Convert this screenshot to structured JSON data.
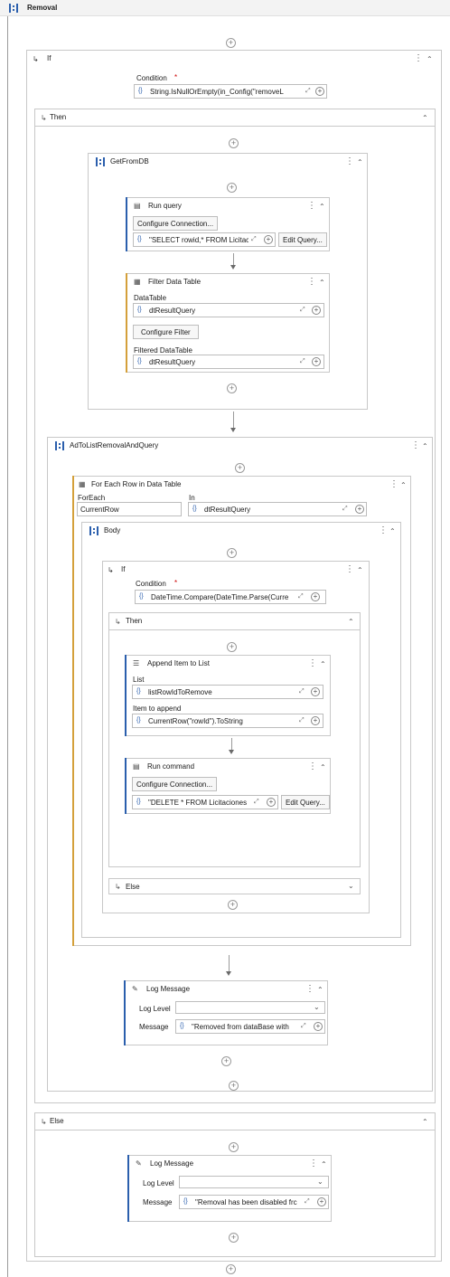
{
  "root": {
    "title": "Removal"
  },
  "if_outer": {
    "title": "If",
    "condition_label": "Condition",
    "required": "*",
    "condition_value": "String.IsNullOrEmpty(in_Config(\"removeL"
  },
  "then_outer": {
    "label": "Then"
  },
  "getfromdb": {
    "title": "GetFromDB"
  },
  "run_query": {
    "title": "Run query",
    "configure": "Configure Connection...",
    "sql": "\"SELECT rowid,* FROM Licitac",
    "edit": "Edit Query..."
  },
  "filter": {
    "title": "Filter Data Table",
    "datatable_label": "DataTable",
    "datatable_value": "dtResultQuery",
    "configure": "Configure Filter",
    "filtered_label": "Filtered DataTable",
    "filtered_value": "dtResultQuery"
  },
  "adtolist": {
    "title": "AdToListRemovalAndQuery"
  },
  "foreach": {
    "title": "For Each Row in Data Table",
    "foreach_label": "ForEach",
    "foreach_value": "CurrentRow",
    "in_label": "In",
    "in_value": "dtResultQuery"
  },
  "body": {
    "title": "Body"
  },
  "if_inner": {
    "title": "If",
    "condition_label": "Condition",
    "required": "*",
    "condition_value": "DateTime.Compare(DateTime.Parse(Curre"
  },
  "then_inner": {
    "label": "Then"
  },
  "append": {
    "title": "Append Item to List",
    "list_label": "List",
    "list_value": "listRowIdToRemove",
    "item_label": "Item to append",
    "item_value": "CurrentRow(\"rowId\").ToString"
  },
  "run_command": {
    "title": "Run command",
    "configure": "Configure Connection...",
    "sql": "\"DELETE * FROM Licitaciones",
    "edit": "Edit Query..."
  },
  "else_inner": {
    "label": "Else"
  },
  "log1": {
    "title": "Log Message",
    "level_label": "Log Level",
    "message_label": "Message",
    "message_value": "\"Removed from dataBase with"
  },
  "else_outer": {
    "label": "Else"
  },
  "log2": {
    "title": "Log Message",
    "level_label": "Log Level",
    "message_label": "Message",
    "message_value": "\"Removal has been disabled frc"
  },
  "icons": {
    "plus": "+",
    "kebab": "⋮",
    "collapse": "⌃",
    "expand": "⌄",
    "brace": "{}",
    "arrow_expand": "⤢"
  },
  "colors": {
    "accent_blue": "#2b5fad",
    "accent_orange": "#d4a03a"
  }
}
